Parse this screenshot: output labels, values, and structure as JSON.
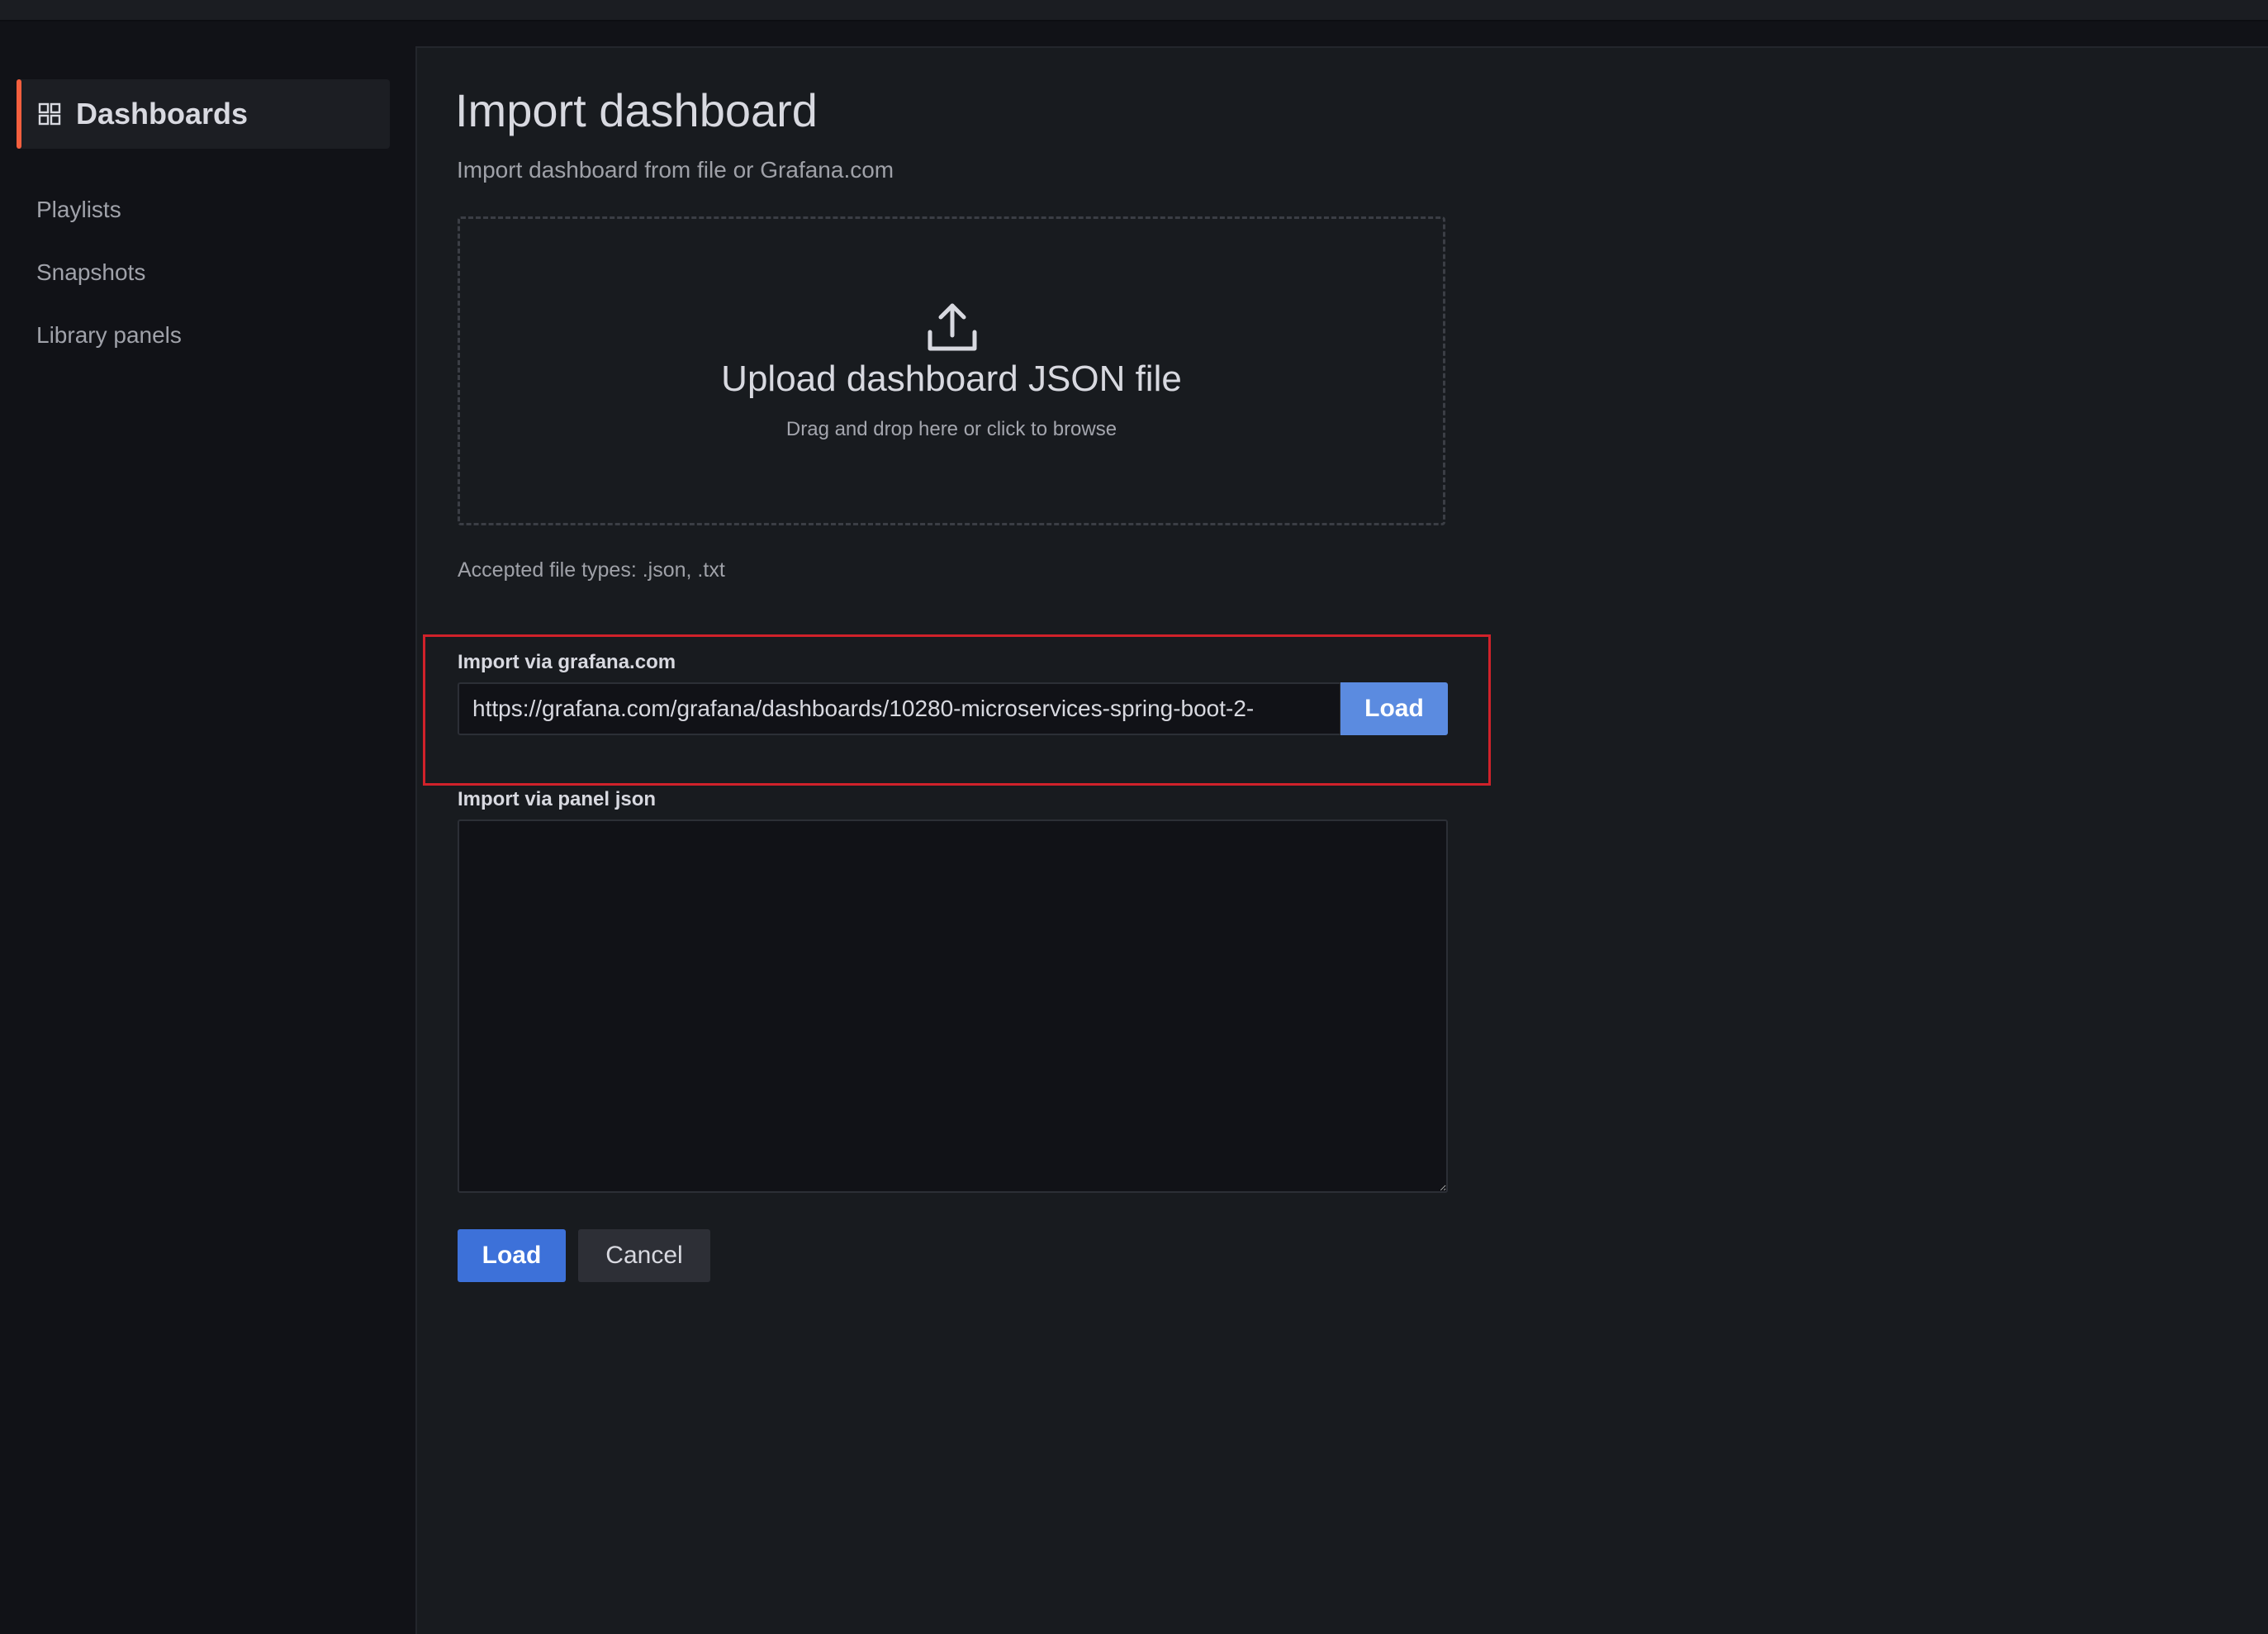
{
  "sidebar": {
    "active_item": {
      "label": "Dashboards",
      "icon": "apps-grid-icon"
    },
    "items": [
      {
        "label": "Playlists"
      },
      {
        "label": "Snapshots"
      },
      {
        "label": "Library panels"
      }
    ],
    "accent_color": "#f55f3e"
  },
  "main": {
    "title": "Import dashboard",
    "subtitle": "Import dashboard from file or Grafana.com",
    "upload": {
      "icon": "upload-icon",
      "title": "Upload dashboard JSON file",
      "hint": "Drag and drop here or click to browse"
    },
    "accepted_types": "Accepted file types: .json, .txt",
    "grafana_import": {
      "label": "Import via grafana.com",
      "url_value": "https://grafana.com/grafana/dashboards/10280-microservices-spring-boot-2-",
      "load_label": "Load",
      "highlight_color": "#d0222a"
    },
    "panel_json": {
      "label": "Import via panel json",
      "value": ""
    },
    "actions": {
      "load_label": "Load",
      "cancel_label": "Cancel"
    }
  }
}
